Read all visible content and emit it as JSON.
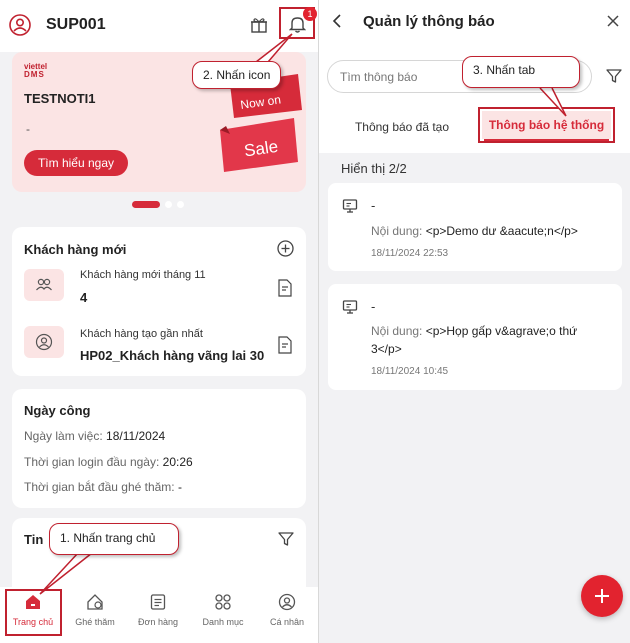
{
  "left": {
    "header": {
      "user_code": "SUP001",
      "notification_count": "1"
    },
    "banner": {
      "brand_line1": "viettel",
      "brand_line2": "DMS",
      "title": "TESTNOTI1",
      "dash": "-",
      "cta_label": "Tìm hiểu ngay",
      "art_text_top": "Now on",
      "art_text_sale": "Sale"
    },
    "new_customers": {
      "title": "Khách hàng mới",
      "items": [
        {
          "label": "Khách hàng mới tháng 11",
          "value": "4",
          "icon": "users-icon"
        },
        {
          "label": "Khách hàng tạo gần nhất",
          "value": "HP02_Khách hàng vãng lai 30",
          "icon": "user-circle-icon"
        }
      ]
    },
    "workday": {
      "title": "Ngày công",
      "lines": [
        {
          "label": "Ngày làm việc: ",
          "value": "18/11/2024"
        },
        {
          "label": "Thời gian login đầu ngày: ",
          "value": "20:26"
        },
        {
          "label": "Thời gian bắt đầu ghé thăm: ",
          "value": "-"
        }
      ]
    },
    "news": {
      "title": "Tin"
    },
    "bottom_nav": [
      {
        "label": "Trang chủ",
        "icon": "home-icon",
        "active": true
      },
      {
        "label": "Ghé thăm",
        "icon": "visit-icon",
        "active": false
      },
      {
        "label": "Đơn hàng",
        "icon": "order-icon",
        "active": false
      },
      {
        "label": "Danh mục",
        "icon": "grid-icon",
        "active": false
      },
      {
        "label": "Cá nhân",
        "icon": "profile-icon",
        "active": false
      }
    ]
  },
  "right": {
    "header": {
      "title": "Quản lý thông báo"
    },
    "search": {
      "placeholder": "Tìm thông báo",
      "value": ""
    },
    "tabs": [
      {
        "label": "Thông báo đã tạo",
        "active": false
      },
      {
        "label": "Thông báo hệ thống",
        "active": true
      }
    ],
    "count_text": "Hiển thị 2/2",
    "notifications": [
      {
        "title": "-",
        "content_label": "Nội dung: ",
        "content": "<p>Demo dư &aacute;n</p>",
        "time": "18/11/2024 22:53"
      },
      {
        "title": "-",
        "content_label": "Nội dung: ",
        "content": "<p>Họp gấp v&agrave;o thứ 3</p>",
        "time": "18/11/2024 10:45"
      }
    ]
  },
  "callouts": {
    "step1": "1. Nhấn trang chủ",
    "step2": "2. Nhấn icon",
    "step3": "3. Nhấn tab"
  },
  "colors": {
    "accent": "#d62b3a",
    "highlight_border": "#c0212f",
    "banner_bg": "#fbe4e4",
    "app_bg": "#f2f2f4"
  }
}
